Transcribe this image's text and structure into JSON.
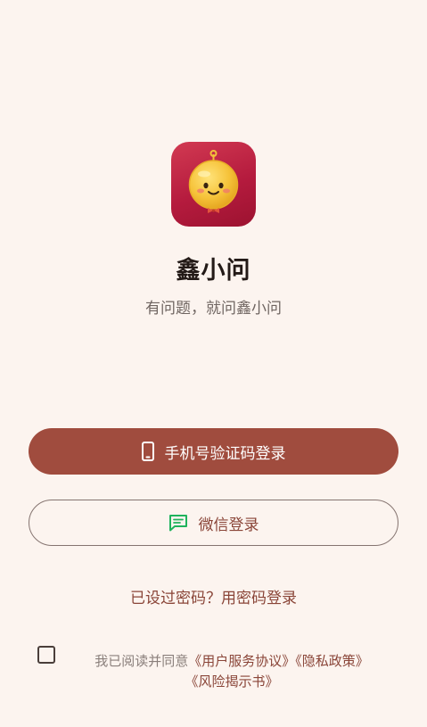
{
  "app": {
    "name": "鑫小问",
    "slogan": "有问题，就问鑫小问"
  },
  "login": {
    "phone_button_label": "手机号验证码登录",
    "wechat_button_label": "微信登录",
    "password_link": "已设过密码？用密码登录"
  },
  "agreement": {
    "checked": false,
    "prefix": "我已阅读并同意",
    "user_agreement": "《用户服务协议》",
    "privacy_policy": "《隐私政策》",
    "risk_disclosure": "《风险揭示书》"
  },
  "colors": {
    "background": "#fcf4ef",
    "primary_button": "#a04c3e",
    "link": "#8a4538",
    "wechat_icon": "#1fb35c",
    "app_icon_red": "#b51b3e"
  },
  "icons": {
    "app_icon": "smiling-coin-mascot-icon",
    "phone_button_icon": "smartphone-icon",
    "wechat_button_icon": "chat-bubble-icon",
    "checkbox": "checkbox-unchecked-icon"
  }
}
